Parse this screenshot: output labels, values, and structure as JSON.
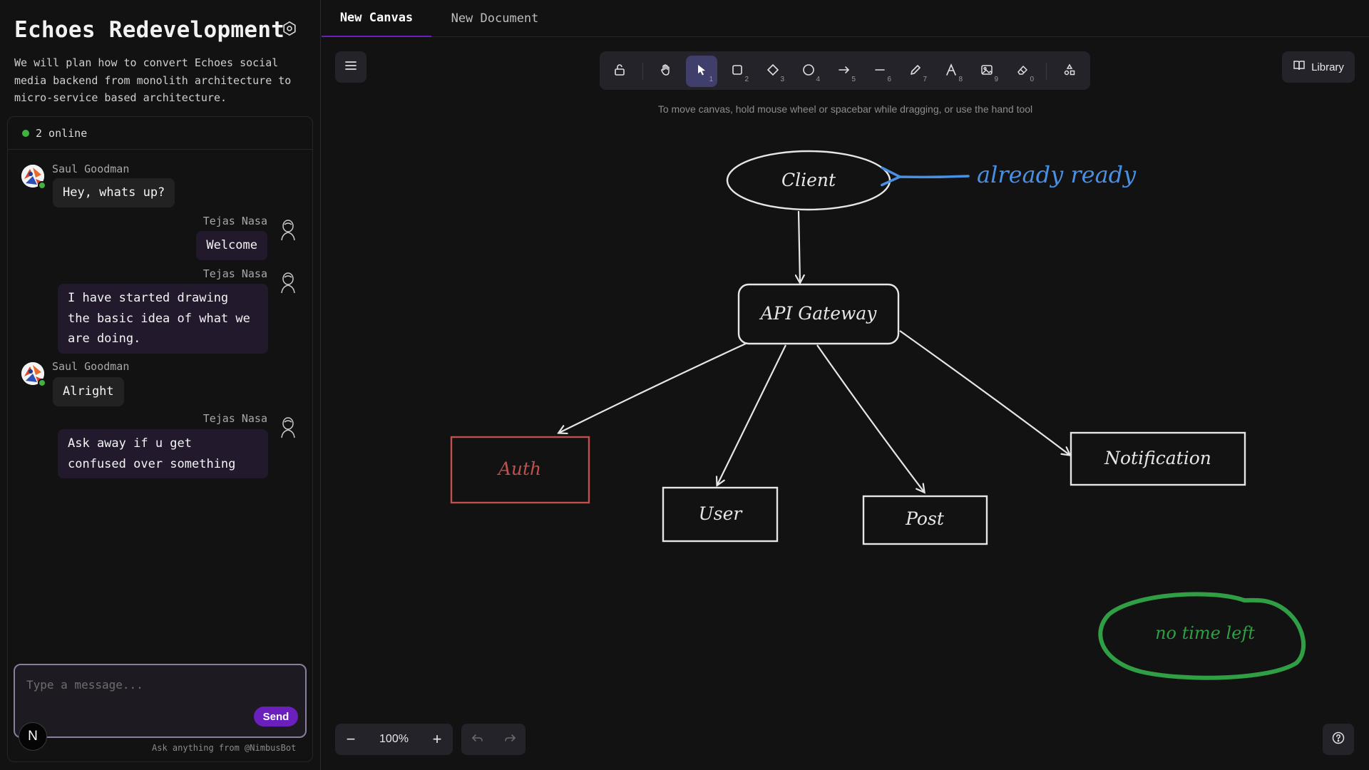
{
  "sidebar": {
    "title": "Echoes Redevelopment",
    "description": "We will plan how to convert Echoes social media backend from monolith architecture to micro-service based architecture.",
    "online_count": "2 online",
    "messages": [
      {
        "author": "Saul Goodman",
        "side": "left",
        "text": "Hey, whats up?"
      },
      {
        "author": "Tejas Nasa",
        "side": "right",
        "text": "Welcome"
      },
      {
        "author": "Tejas Nasa",
        "side": "right",
        "text": "I have started drawing\nthe basic idea of what we\nare doing."
      },
      {
        "author": "Saul Goodman",
        "side": "left",
        "text": "Alright"
      },
      {
        "author": "Tejas Nasa",
        "side": "right",
        "text": "Ask away if u get\nconfused over something"
      }
    ],
    "composer": {
      "placeholder": "Type a message...",
      "send_label": "Send",
      "bot_label": "N",
      "bot_hint": "Ask anything from @NimbusBot"
    }
  },
  "tabs": [
    {
      "label": "New Canvas",
      "active": true
    },
    {
      "label": "New Document",
      "active": false
    }
  ],
  "toolbar": {
    "tools": [
      {
        "icon": "lock-icon",
        "key": ""
      },
      {
        "icon": "hand-icon",
        "key": ""
      },
      {
        "icon": "pointer-icon",
        "key": "1",
        "active": true
      },
      {
        "icon": "rectangle-icon",
        "key": "2"
      },
      {
        "icon": "diamond-icon",
        "key": "3"
      },
      {
        "icon": "ellipse-icon",
        "key": "4"
      },
      {
        "icon": "arrow-icon",
        "key": "5"
      },
      {
        "icon": "line-icon",
        "key": "6"
      },
      {
        "icon": "pencil-icon",
        "key": "7"
      },
      {
        "icon": "text-icon",
        "key": "8"
      },
      {
        "icon": "image-icon",
        "key": "9"
      },
      {
        "icon": "eraser-icon",
        "key": "0"
      },
      {
        "icon": "extra-tools-icon",
        "key": ""
      }
    ],
    "hint": "To move canvas, hold mouse wheel or spacebar while dragging, or use the hand tool",
    "library_label": "Library"
  },
  "canvas": {
    "nodes": {
      "client": "Client",
      "gateway": "API Gateway",
      "auth": "Auth",
      "user": "User",
      "post": "Post",
      "notification": "Notification"
    },
    "annotations": {
      "ready": "already ready",
      "time": "no time left"
    },
    "colors": {
      "stroke": "#e6e6e6",
      "auth": "#c0504d",
      "annotation_blue": "#4a90e2",
      "annotation_green": "#2f9e44",
      "accent": "#6b1fbd"
    }
  },
  "footer": {
    "zoom": "100%",
    "zoom_out": "−",
    "zoom_in": "+"
  }
}
